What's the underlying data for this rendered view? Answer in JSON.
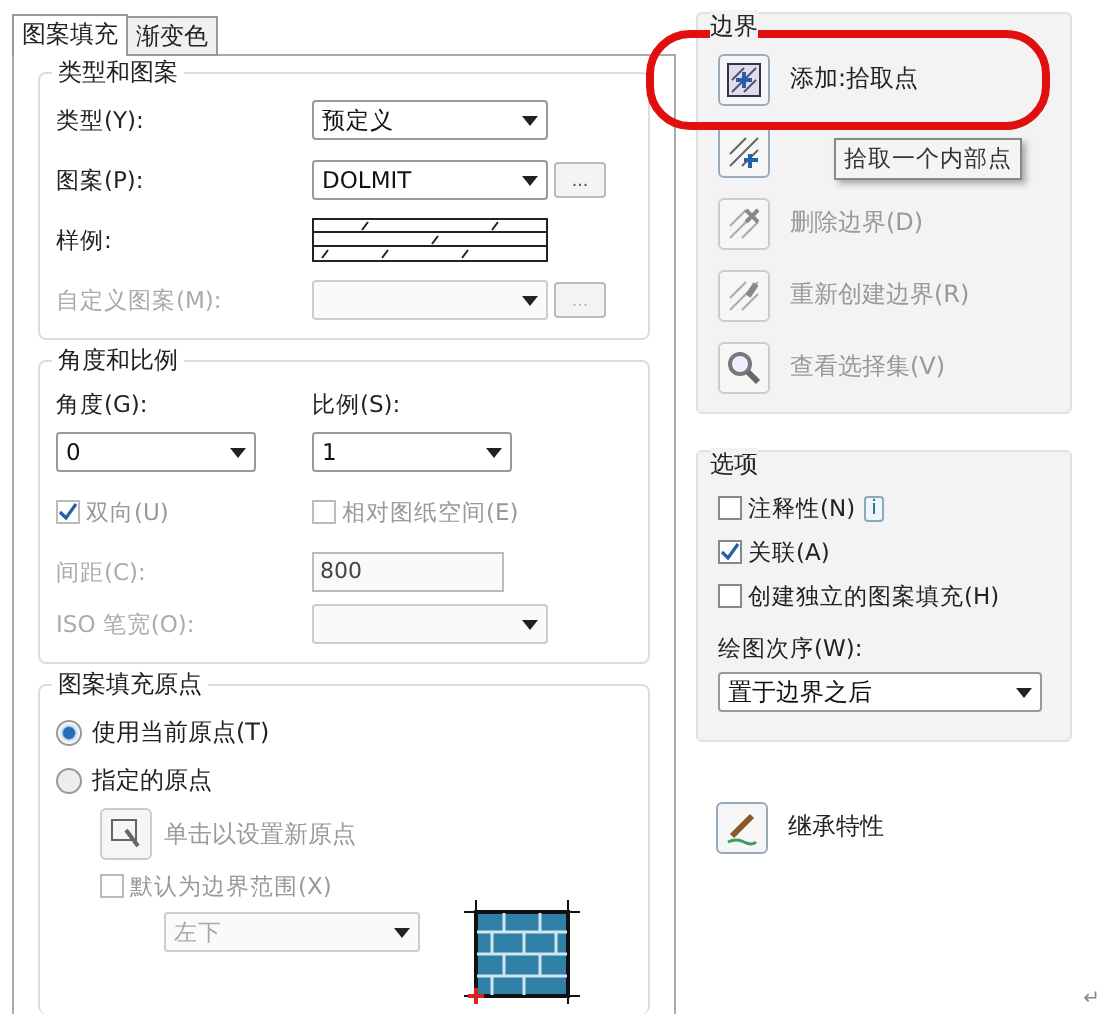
{
  "tabs": [
    {
      "label": "图案填充",
      "selected": true
    },
    {
      "label": "渐变色",
      "selected": false
    }
  ],
  "type_and_pattern": {
    "title": "类型和图案",
    "rows": [
      {
        "kind": "select",
        "label": "类型(Y):",
        "value": "预定义",
        "disabled": false
      },
      {
        "kind": "select",
        "label": "图案(P):",
        "value": "DOLMIT",
        "browse": "...",
        "disabled": false
      },
      {
        "kind": "swatch",
        "label": "样例:",
        "disabled": false
      },
      {
        "kind": "select",
        "label": "自定义图案(M):",
        "browse": "...",
        "disabled": true
      }
    ]
  },
  "angle_scale": {
    "title": "角度和比例",
    "angle": {
      "label": "角度(G):",
      "value": "0"
    },
    "scale": {
      "label": "比例(S):",
      "value": "1"
    },
    "checks": [
      {
        "label": "双向(U)",
        "checked": true,
        "disabled": true
      },
      {
        "label": "相对图纸空间(E)",
        "checked": false,
        "disabled": true
      }
    ],
    "spacing": {
      "label": "间距(C):",
      "value": "800",
      "disabled": true
    },
    "iso_pen": {
      "label": "ISO 笔宽(O):",
      "disabled": true
    }
  },
  "origin": {
    "title": "图案填充原点",
    "radios": [
      {
        "label": "使用当前原点(T)",
        "selected": true
      },
      {
        "label": "指定的原点",
        "selected": false
      }
    ],
    "set_button": {
      "label": "单击以设置新原点",
      "disabled": true
    },
    "default_extent": {
      "label": "默认为边界范围(X)",
      "checked": false,
      "disabled": true
    },
    "position": {
      "value": "左下",
      "disabled": true
    }
  },
  "boundary": {
    "title": "边界",
    "buttons": [
      {
        "kind": "pick",
        "label": "添加:拾取点",
        "disabled": false
      },
      {
        "kind": "select",
        "disabled": false
      },
      {
        "kind": "remove",
        "label": "删除边界(D)",
        "disabled": true
      },
      {
        "kind": "recreate",
        "label": "重新创建边界(R)",
        "disabled": true
      },
      {
        "kind": "view",
        "label": "查看选择集(V)",
        "disabled": true
      }
    ],
    "tooltip": "拾取一个内部点"
  },
  "options": {
    "title": "选项",
    "checks": [
      {
        "label": "注释性(N)",
        "checked": false,
        "info": "i"
      },
      {
        "label": "关联(A)",
        "checked": true
      },
      {
        "label": "创建独立的图案填充(H)",
        "checked": false
      }
    ],
    "draw_order": {
      "label": "绘图次序(W):",
      "value": "置于边界之后"
    }
  },
  "inherit": {
    "label": "继承特性"
  },
  "paragraph_mark": "↵"
}
